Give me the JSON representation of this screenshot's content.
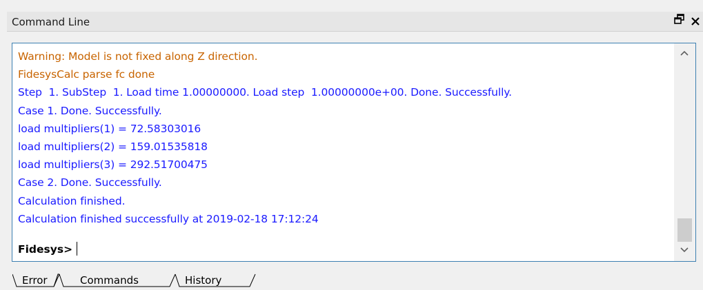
{
  "panel": {
    "title": "Command Line",
    "float_glyph": "Ɖ",
    "close_glyph": "✕"
  },
  "console": {
    "partial_top_line": "",
    "lines": [
      {
        "text": "Warning: Model is not fixed along Z direction.",
        "kind": "warning"
      },
      {
        "text": "FidesysCalc parse fc done",
        "kind": "warning"
      },
      {
        "text": "Step  1. SubStep  1. Load time 1.00000000. Load step  1.00000000e+00. Done. Successfully.",
        "kind": "info"
      },
      {
        "text": "Case 1. Done. Successfully.",
        "kind": "info"
      },
      {
        "text": "load multipliers(1) = 72.58303016",
        "kind": "info"
      },
      {
        "text": "load multipliers(2) = 159.01535818",
        "kind": "info"
      },
      {
        "text": "load multipliers(3) = 292.51700475",
        "kind": "info"
      },
      {
        "text": "Case 2. Done. Successfully.",
        "kind": "info"
      },
      {
        "text": "Calculation finished.",
        "kind": "info"
      },
      {
        "text": "Calculation finished successfully at 2019-02-18 17:12:24",
        "kind": "info"
      }
    ],
    "prompt": "Fidesys>",
    "input_value": ""
  },
  "tabs": [
    {
      "label": "Error"
    },
    {
      "label": "Commands"
    },
    {
      "label": "History"
    }
  ],
  "colors": {
    "warning": "#c86400",
    "info": "#1a1aff",
    "border": "#3c7fb1"
  },
  "icons": {
    "float": "float-window-icon",
    "close": "close-icon",
    "scroll_up": "chevron-up-icon",
    "scroll_down": "chevron-down-icon"
  }
}
